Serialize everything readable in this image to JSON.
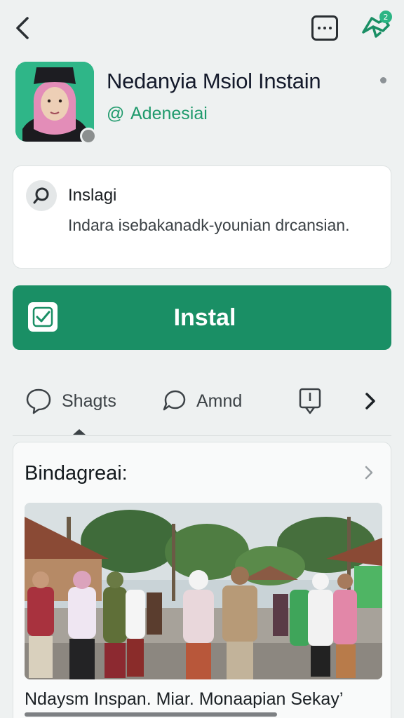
{
  "header": {
    "back_icon": "chevron-left-icon",
    "more_icon": "more-horizontal-icon",
    "share_icon": "share-notification-icon"
  },
  "app": {
    "name": "Nedanyia Msiol Instain",
    "developer_prefix": "@",
    "developer": "Adenesiai"
  },
  "info_card": {
    "title": "Inslagi",
    "description": "Indara isebakanadk-younian drcansian."
  },
  "install": {
    "label": "Instal"
  },
  "tabs": [
    {
      "label": "Shagts",
      "icon": "chat-bubble-icon"
    },
    {
      "label": "Amnd",
      "icon": "comment-icon"
    },
    {
      "label": "",
      "icon": "report-icon"
    }
  ],
  "section": {
    "title": "Bindagreai:",
    "caption": "Ndaysm Inspan. Miar. Monaapian Sekay’"
  },
  "colors": {
    "accent": "#1a8f65",
    "developer": "#1f9a6c",
    "background": "#eef1f1"
  }
}
